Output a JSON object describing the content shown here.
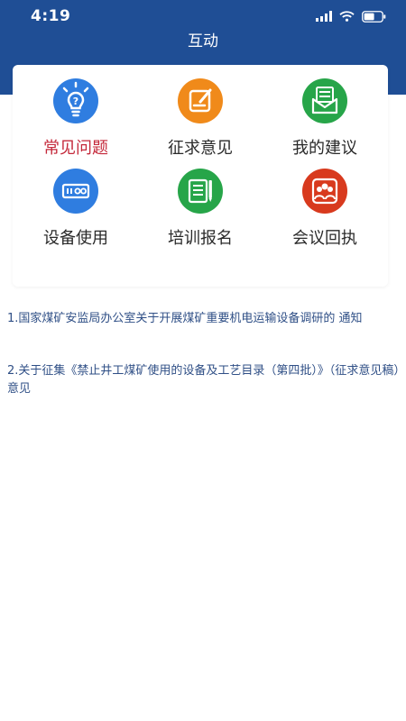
{
  "status_bar": {
    "time": "4:19",
    "signal_icon": "cellular-signal-icon",
    "wifi_icon": "wifi-icon",
    "battery_icon": "battery-icon"
  },
  "header": {
    "title": "互动",
    "background": "#1f4e95"
  },
  "grid": {
    "items": [
      {
        "label": "常见问题",
        "icon": "lightbulb-question-icon",
        "color": "#2f7de0",
        "active": true
      },
      {
        "label": "征求意见",
        "icon": "edit-document-icon",
        "color": "#f08a1a",
        "active": false
      },
      {
        "label": "我的建议",
        "icon": "envelope-icon",
        "color": "#27a549",
        "active": false
      },
      {
        "label": "设备使用",
        "icon": "device-panel-icon",
        "color": "#2f7de0",
        "active": false
      },
      {
        "label": "培训报名",
        "icon": "form-pen-icon",
        "color": "#27a549",
        "active": false
      },
      {
        "label": "会议回执",
        "icon": "meeting-people-icon",
        "color": "#d83a1e",
        "active": false
      }
    ]
  },
  "articles": [
    "1.国家煤矿安监局办公室关于开展煤矿重要机电运输设备调研的 通知",
    "2.关于征集《禁止井工煤矿使用的设备及工艺目录（第四批）》（征求意见稿）意见"
  ]
}
